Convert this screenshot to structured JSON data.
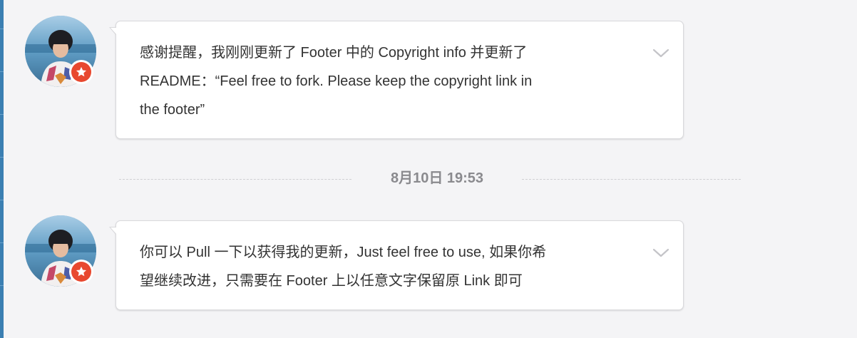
{
  "messages": [
    {
      "text": "感谢提醒，我刚刚更新了 Footer 中的 Copyright info 并更新了\nREADME：“Feel free to fork. Please keep the copyright link in\nthe footer”",
      "avatar_icon": "user-avatar",
      "badge_icon": "star-badge-icon",
      "menu_icon": "chevron-down-icon"
    },
    {
      "text": "你可以 Pull 一下以获得我的更新，Just feel free to use, 如果你希\n望继续改进，只需要在 Footer 上以任意文字保留原 Link 即可",
      "avatar_icon": "user-avatar",
      "badge_icon": "star-badge-icon",
      "menu_icon": "chevron-down-icon"
    }
  ],
  "timestamp_divider": {
    "label": "8月10日 19:53"
  },
  "colors": {
    "background": "#f4f4f6",
    "bubble": "#ffffff",
    "text": "#333333",
    "timestamp": "#8a8a8e",
    "badge": "#e8482f",
    "left_edge": "#3b7fb2"
  }
}
